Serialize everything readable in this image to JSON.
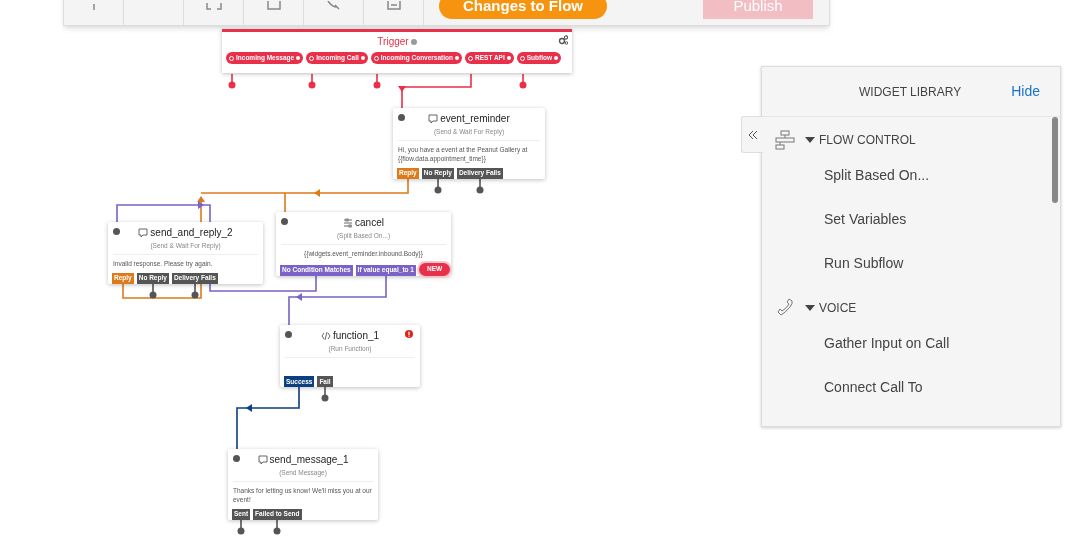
{
  "toolbar": {
    "changes_button": "Changes to Flow",
    "publish_button": "Publish"
  },
  "trigger": {
    "title": "Trigger",
    "ports": [
      {
        "label": "Incoming Message"
      },
      {
        "label": "Incoming Call"
      },
      {
        "label": "Incoming Conversation"
      },
      {
        "label": "REST API"
      },
      {
        "label": "Subflow"
      }
    ]
  },
  "widgets": [
    {
      "kind": "message",
      "title": "event_reminder",
      "subtitle": "(Send & Wait For Reply)",
      "body": "Hi, you have a event at the Peanut Gallery at {{flow.data.appointment_time}}",
      "error": false,
      "ports": [
        {
          "label": "Reply",
          "kind": "reply"
        },
        {
          "label": "No Reply",
          "kind": "plain"
        },
        {
          "label": "Delivery Fails",
          "kind": "plain"
        }
      ]
    },
    {
      "kind": "message",
      "title": "send_and_reply_2",
      "subtitle": "(Send & Wait For Reply)",
      "body": "Invalid response. Please try again.",
      "error": false,
      "ports": [
        {
          "label": "Reply",
          "kind": "reply"
        },
        {
          "label": "No Reply",
          "kind": "plain"
        },
        {
          "label": "Delivery Fails",
          "kind": "plain"
        }
      ]
    },
    {
      "kind": "split",
      "title": "cancel",
      "subtitle": "(Split Based On...)",
      "body": "{{widgets.event_reminder.inbound.Body}}",
      "error": false,
      "ports": [
        {
          "label": "No Condition Matches",
          "kind": "condition"
        },
        {
          "label": "If value equal_to 1",
          "kind": "condition"
        },
        {
          "label": "NEW",
          "kind": "new"
        }
      ]
    },
    {
      "kind": "function",
      "title": "function_1",
      "subtitle": "(Run Function)",
      "error": true,
      "ports": [
        {
          "label": "Success",
          "kind": "success"
        },
        {
          "label": "Fail",
          "kind": "plain"
        }
      ]
    },
    {
      "kind": "message",
      "title": "send_message_1",
      "subtitle": "(Send Message)",
      "body": "Thanks for letting us know! We'll miss you at our event!",
      "error": false,
      "ports": [
        {
          "label": "Sent",
          "kind": "plain"
        },
        {
          "label": "Failed to Send",
          "kind": "plain"
        }
      ]
    }
  ],
  "library": {
    "title": "WIDGET LIBRARY",
    "hide_link": "Hide",
    "sections": [
      {
        "kind": "flow",
        "title": "FLOW CONTROL",
        "expanded": true,
        "items": [
          "Split Based On...",
          "Set Variables",
          "Run Subflow"
        ]
      },
      {
        "kind": "voice",
        "title": "VOICE",
        "expanded": true,
        "items": [
          "Gather Input on Call",
          "Connect Call To"
        ]
      }
    ]
  }
}
